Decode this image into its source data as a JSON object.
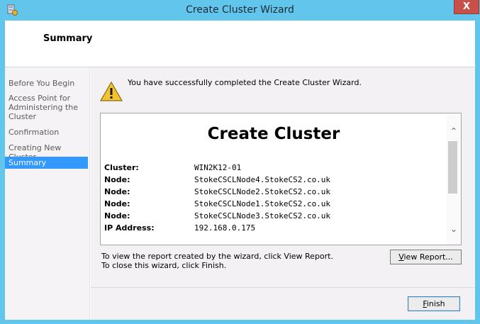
{
  "window": {
    "title": "Create Cluster Wizard",
    "close_glyph": "X",
    "app_icon": "cluster-wizard-icon",
    "accent": "#62c6ec"
  },
  "header": {
    "title": "Summary"
  },
  "nav": {
    "items": [
      {
        "label": "Before You Begin"
      },
      {
        "label": "Access Point for Administering the Cluster"
      },
      {
        "label": "Confirmation"
      },
      {
        "label": "Creating New Cluster"
      },
      {
        "label": "Summary"
      }
    ],
    "selected_index": 4,
    "selected_color": "#3399ff"
  },
  "main": {
    "icon": "warning-icon",
    "message": "You have successfully completed the Create Cluster Wizard.",
    "report": {
      "title": "Create Cluster",
      "rows": [
        {
          "label": "Cluster:",
          "value": "WIN2K12-01"
        },
        {
          "label": "Node:",
          "value": "StokeCSCLNode4.StokeCS2.co.uk"
        },
        {
          "label": "Node:",
          "value": "StokeCSCLNode2.StokeCS2.co.uk"
        },
        {
          "label": "Node:",
          "value": "StokeCSCLNode1.StokeCS2.co.uk"
        },
        {
          "label": "Node:",
          "value": "StokeCSCLNode3.StokeCS2.co.uk"
        },
        {
          "label": "IP Address:",
          "value": "192.168.0.175"
        }
      ]
    },
    "hint_view": "To view the report created by the wizard, click View Report.",
    "hint_close": "To close this wizard, click Finish.",
    "view_report_button": "View Report...",
    "view_report_mnemonic": "V",
    "view_report_rest": "iew Report..."
  },
  "footer": {
    "finish_button": "Finish",
    "finish_mnemonic": "F",
    "finish_rest": "inish"
  }
}
